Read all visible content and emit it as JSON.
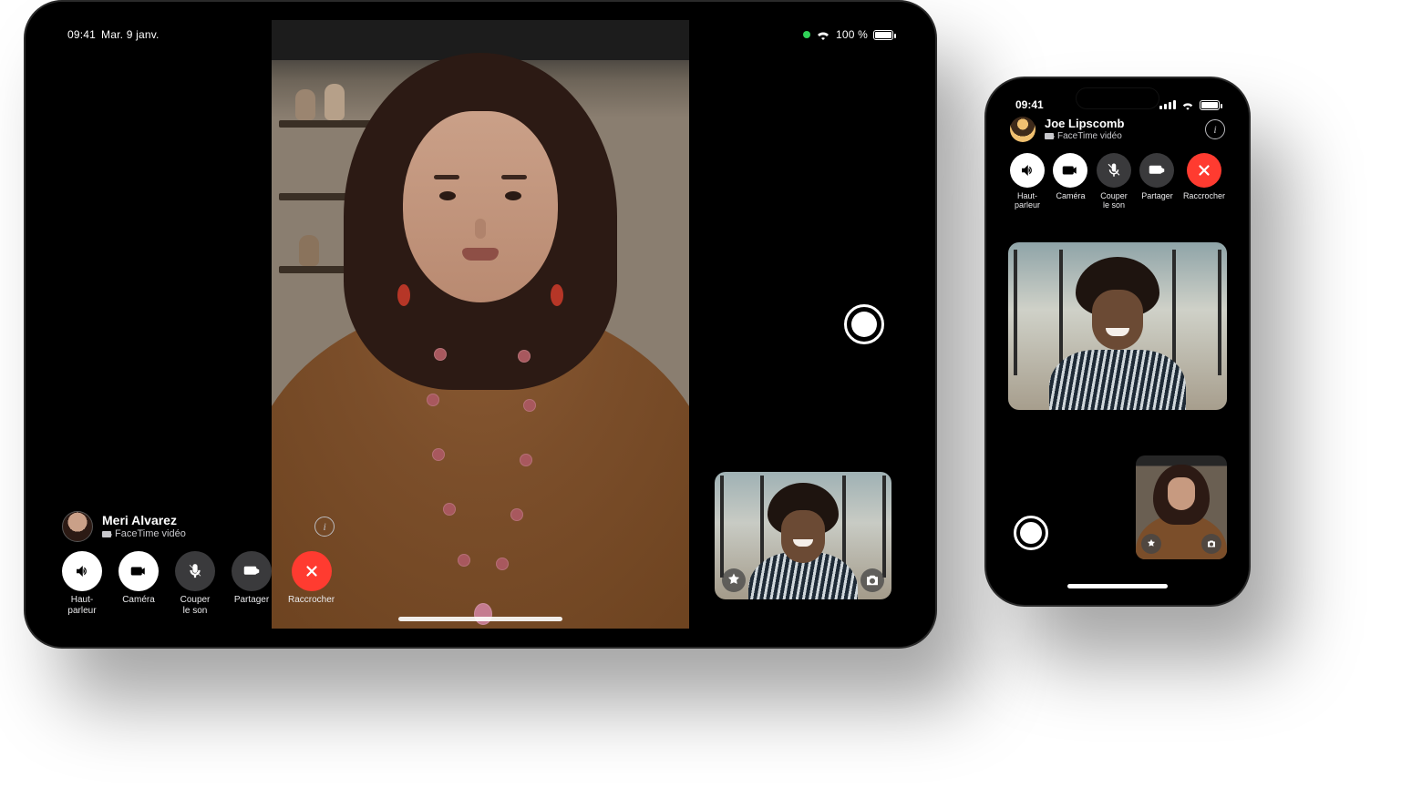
{
  "ipad": {
    "status": {
      "time": "09:41",
      "date": "Mar. 9 janv.",
      "battery_text": "100 %"
    },
    "call": {
      "name": "Meri Alvarez",
      "subtitle": "FaceTime vidéo"
    },
    "controls": {
      "speaker": "Haut-\nparleur",
      "camera": "Caméra",
      "mute": "Couper\nle son",
      "share": "Partager",
      "end": "Raccrocher"
    }
  },
  "iphone": {
    "status": {
      "time": "09:41"
    },
    "call": {
      "name": "Joe Lipscomb",
      "subtitle": "FaceTime vidéo"
    },
    "controls": {
      "speaker": "Haut-\nparleur",
      "camera": "Caméra",
      "mute": "Couper\nle son",
      "share": "Partager",
      "end": "Raccrocher"
    }
  },
  "colors": {
    "accent_red": "#ff3b30"
  }
}
